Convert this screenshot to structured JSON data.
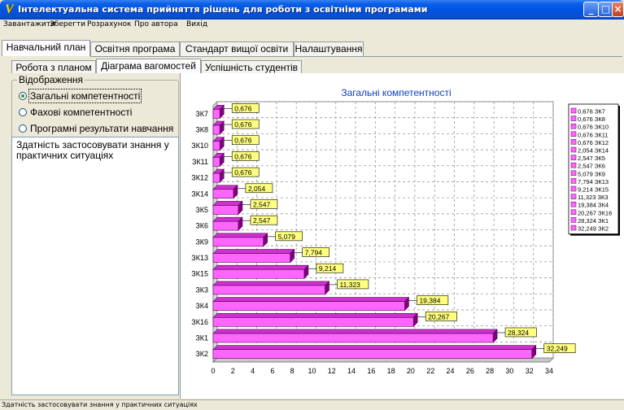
{
  "window": {
    "title": "Інтелектуальна система прийняття рішень для роботи з освітніми програмами",
    "icon": "logo-icon",
    "controls": [
      "minimize",
      "maximize",
      "close"
    ]
  },
  "menu": [
    "Завантажити",
    "Зберегти",
    "Розрахунок",
    "Про автора",
    "Вихід"
  ],
  "main_tabs": [
    "Навчальний план",
    "Освітня програма",
    "Стандарт вищої освіти",
    "Налаштування"
  ],
  "sub_tabs": [
    "Робота з планом",
    "Діаграма вагомостей",
    "Успішність студентів"
  ],
  "active_main_tab": "Навчальний план",
  "active_sub_tab": "Діаграма вагомостей",
  "display_group": {
    "title": "Відображення",
    "options": [
      "Загальні компетентності",
      "Фахові компетентності",
      "Програмні результати навчання"
    ],
    "selected": "Загальні компетентності"
  },
  "memo_text": "Здатність застосовувати знання у практичних ситуаціях",
  "status_text": "Здатність застосовувати знання у практичних ситуаціях",
  "colors": {
    "bar_front": "#ff66ff",
    "bar_top": "#d030d0",
    "bar_side": "#800080",
    "label_bg": "#ffff80",
    "title": "#1040c0",
    "titlebar": "#0054e3"
  },
  "chart_data": {
    "type": "bar",
    "orientation": "horizontal",
    "title": "Загальні компетентності",
    "categories": [
      "ЗК7",
      "ЗК8",
      "ЗК10",
      "ЗК11",
      "ЗК12",
      "ЗК14",
      "ЗК5",
      "ЗК6",
      "ЗК9",
      "ЗК13",
      "ЗК15",
      "ЗК3",
      "ЗК4",
      "ЗК16",
      "ЗК1",
      "ЗК2"
    ],
    "values": [
      0.676,
      0.676,
      0.676,
      0.676,
      0.676,
      2.054,
      2.547,
      2.547,
      5.079,
      7.794,
      9.214,
      11.323,
      19.384,
      20.267,
      28.324,
      32.249
    ],
    "labels": [
      "0,676",
      "0,676",
      "0,676",
      "0,676",
      "0,676",
      "2,054",
      "2,547",
      "2,547",
      "5,079",
      "7,794",
      "9,214",
      "11,323",
      "19,384",
      "20,267",
      "28,324",
      "32,249"
    ],
    "legend": [
      "0,676 ЗК7",
      "0,676 ЗК8",
      "0,676 ЗК10",
      "0,676 ЗК11",
      "0,676 ЗК12",
      "2,054 ЗК14",
      "2,547 ЗК5",
      "2,547 ЗК6",
      "5,079 ЗК9",
      "7,794 ЗК13",
      "9,214 ЗК15",
      "11,323 ЗК3",
      "19,384 ЗК4",
      "20,267 ЗК16",
      "28,324 ЗК1",
      "32,249 ЗК2"
    ],
    "xticks": [
      "0",
      "2",
      "4",
      "6",
      "8",
      "10",
      "12",
      "14",
      "16",
      "18",
      "20",
      "22",
      "24",
      "26",
      "28",
      "30",
      "32",
      "34"
    ],
    "xlim": [
      0,
      34
    ],
    "grid": true,
    "legend_position": "right",
    "style": "3d"
  }
}
